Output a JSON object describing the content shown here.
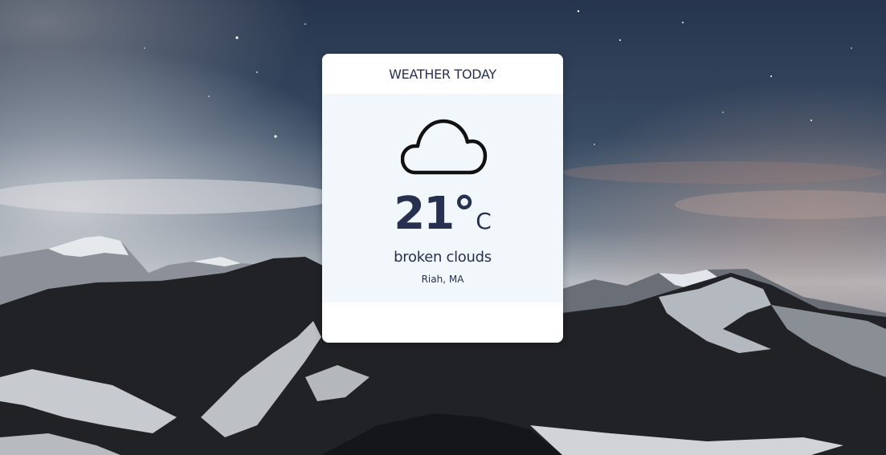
{
  "widget": {
    "title": "WEATHER TODAY",
    "icon": "cloud-icon",
    "temperature": "21°",
    "unit": "C",
    "condition": "broken clouds",
    "location": "Riah, MA"
  },
  "colors": {
    "text": "#27304f",
    "card_background": "#ffffff",
    "panel_background": "#f2f7fc",
    "sky_top": "#22324a",
    "mountain_dark": "#1d1f22",
    "snow": "#dde3e8"
  },
  "background": {
    "scene": "night-sky-mountains"
  }
}
